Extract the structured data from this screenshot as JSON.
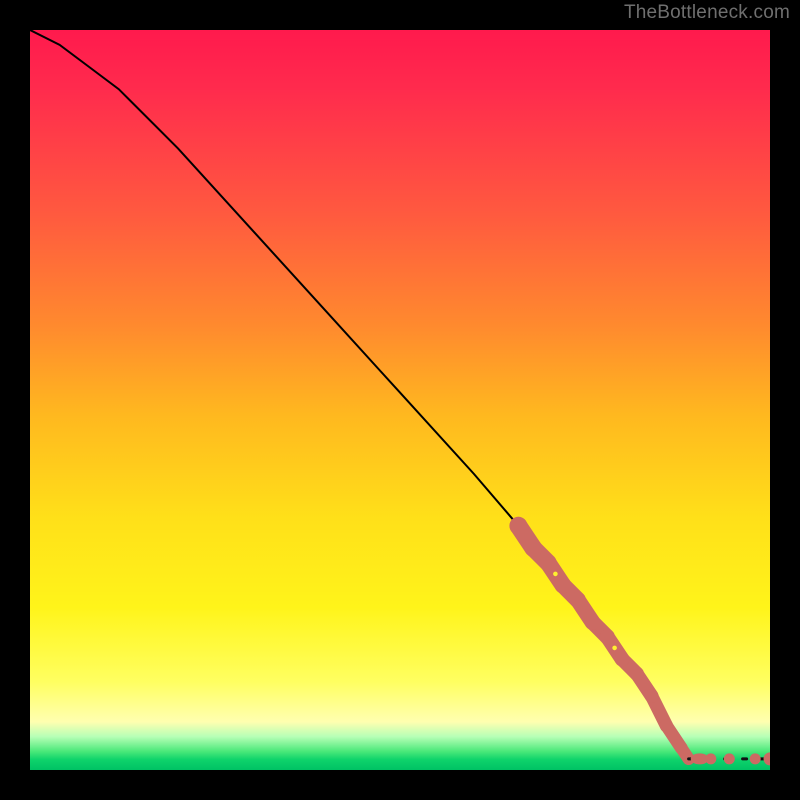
{
  "attribution": "TheBottleneck.com",
  "colors": {
    "blob": "#cc6a63",
    "line": "#000000"
  },
  "chart_data": {
    "type": "line",
    "title": "",
    "xlabel": "",
    "ylabel": "",
    "xlim": [
      0,
      100
    ],
    "ylim": [
      0,
      100
    ],
    "grid": false,
    "legend": false,
    "series": [
      {
        "name": "curve",
        "x": [
          0,
          4,
          8,
          12,
          20,
          30,
          40,
          50,
          60,
          66,
          70,
          74,
          78,
          82,
          84,
          86,
          88,
          89
        ],
        "y": [
          100,
          98,
          95,
          92,
          84,
          73,
          62,
          51,
          40,
          33,
          28,
          23,
          18,
          13,
          10,
          6,
          3,
          1.5
        ]
      },
      {
        "name": "highlighted-segment",
        "kind": "thick-scatter",
        "x": [
          66,
          68,
          70,
          72,
          74,
          76,
          78,
          80,
          82,
          84,
          86,
          88,
          89
        ],
        "y": [
          33,
          30,
          28,
          25,
          23,
          20,
          18,
          15,
          13,
          10,
          6,
          3,
          1.5
        ]
      },
      {
        "name": "tail-dots",
        "kind": "dashed",
        "x": [
          89,
          92,
          94.5,
          98,
          100
        ],
        "y": [
          1.5,
          1.5,
          1.5,
          1.5,
          1.5
        ]
      }
    ],
    "notes": "Axes and tick labels are not rendered on the source image; values above are proportional estimates (0–100) read from relative position within the 740×740 plot area."
  }
}
